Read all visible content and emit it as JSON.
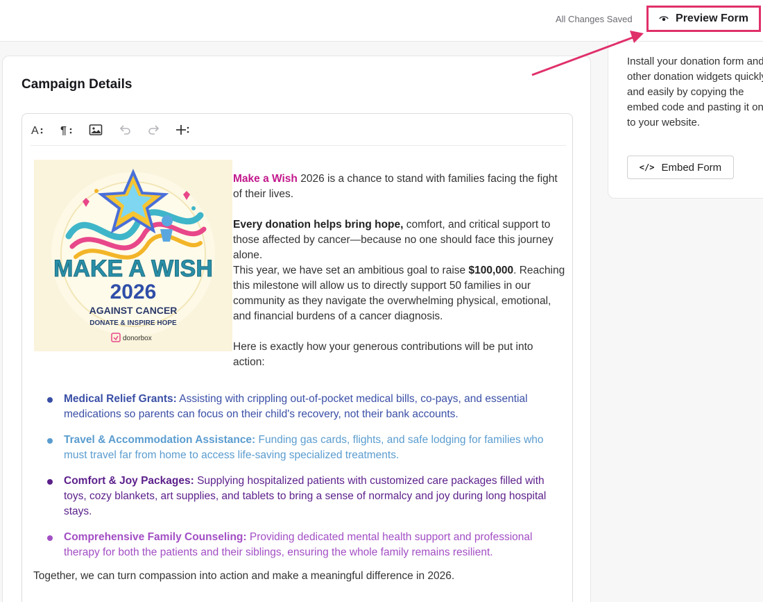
{
  "header": {
    "status": "All Changes Saved",
    "preview_label": "Preview Form"
  },
  "campaign": {
    "title": "Campaign Details"
  },
  "toolbar": {
    "items": [
      "text-format-icon",
      "paragraph-icon",
      "image-icon",
      "undo-icon",
      "redo-icon",
      "insert-icon"
    ]
  },
  "hero_image": {
    "line1": "MAKE A WISH",
    "line2": "2026",
    "line3": "AGAINST CANCER",
    "line4": "DONATE & INSPIRE HOPE",
    "brand": "donorbox"
  },
  "body": {
    "intro_brand": "Make a Wish",
    "intro_rest": " 2026 is a chance to stand with families facing the fight of their lives.",
    "p2_bold": "Every donation helps bring hope,",
    "p2_rest": " comfort, and critical support to those affected by cancer—because no one should face this journey alone.",
    "p3_start": "This year, we have set an ambitious goal to raise ",
    "p3_goal": "$100,000",
    "p3_rest": ". Reaching this milestone will allow us to directly support 50 families in our community as they navigate the overwhelming physical, emotional, and financial burdens of a cancer diagnosis.",
    "p4": "Here is exactly how your generous contributions will be put into action:"
  },
  "list": [
    {
      "title": "Medical Relief Grants:",
      "text": " Assisting with crippling out-of-pocket medical bills, co-pays, and essential medications so parents can focus on their child's recovery, not their bank accounts.",
      "color": "#3a4fa6"
    },
    {
      "title": "Travel & Accommodation Assistance:",
      "text": " Funding gas cards, flights, and safe lodging for families who must travel far from home to access life-saving specialized treatments.",
      "color": "#5a9ccf"
    },
    {
      "title": "Comfort & Joy Packages:",
      "text": " Supplying hospitalized patients with customized care packages filled with toys, cozy blankets, art supplies, and tablets to bring a sense of normalcy and joy during long hospital stays.",
      "color": "#5b1f8a"
    },
    {
      "title": "Comprehensive Family Counseling:",
      "text": " Providing dedicated mental health support and professional therapy for both the patients and their siblings, ensuring the whole family remains resilient.",
      "color": "#a24ec4"
    }
  ],
  "closing": "Together, we can turn compassion into action and make a meaningful difference in 2026.",
  "sidebar": {
    "description": "Install your donation form and other donation widgets quickly and easily by copying the embed code and pasting it on to your website.",
    "embed_label": "Embed Form",
    "embed_icon_glyph": "</>"
  },
  "colors": {
    "highlight": "#e0306a",
    "brand_text": "#c2188c"
  }
}
